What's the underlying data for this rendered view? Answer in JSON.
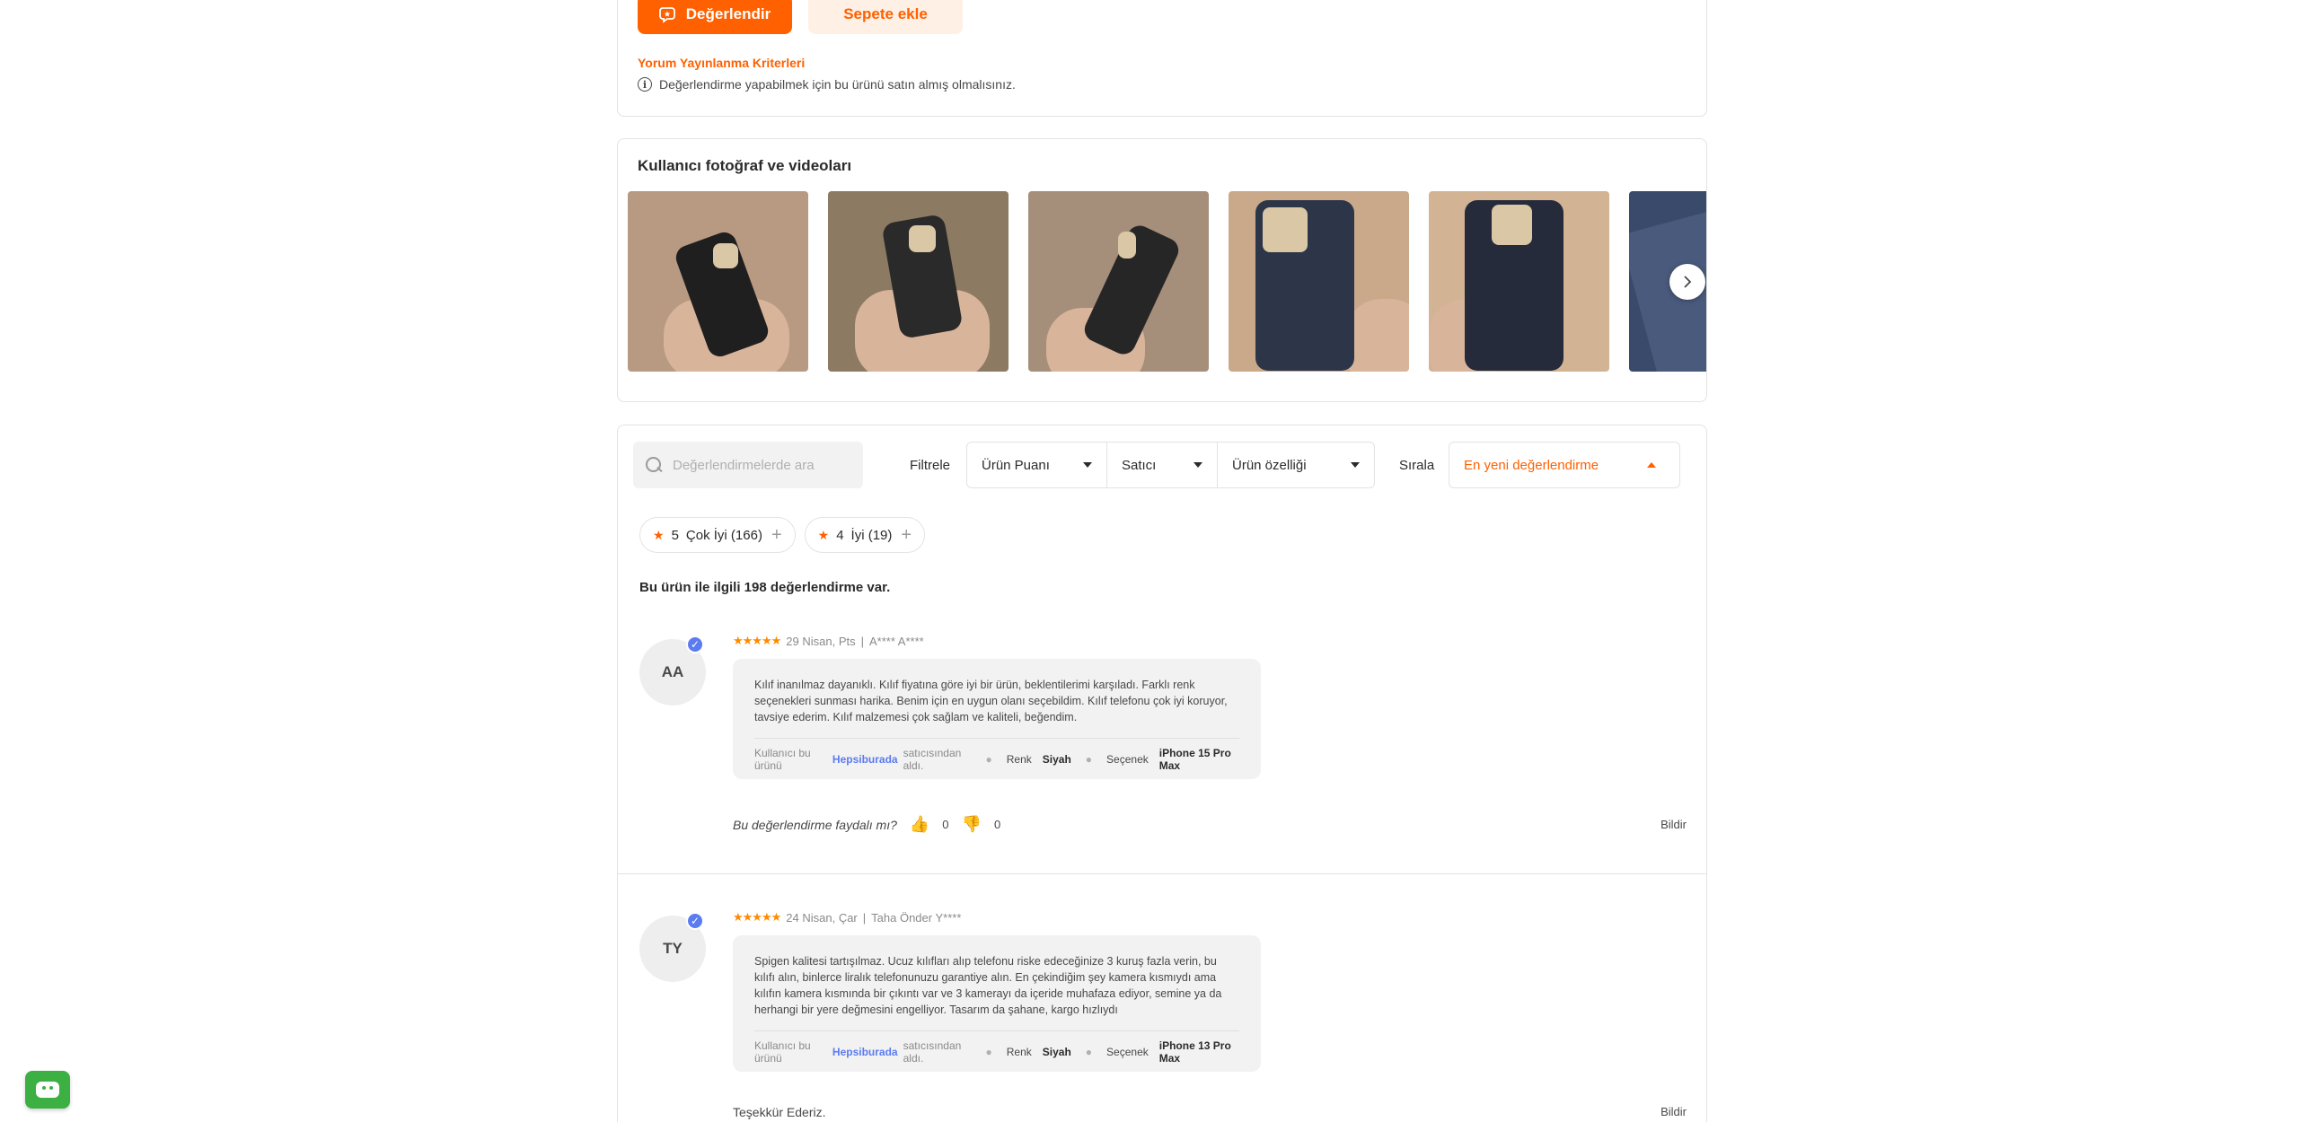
{
  "actions": {
    "rate_label": "Değerlendir",
    "cart_label": "Sepete ekle",
    "criteria_link": "Yorum Yayınlanma Kriterleri",
    "criteria_note": "Değerlendirme yapabilmek için bu ürünü satın almış olmalısınız."
  },
  "photos": {
    "title": "Kullanıcı fotoğraf ve videoları",
    "items": [
      {
        "bg": "#b89a83",
        "phone": "#1f1f1f"
      },
      {
        "bg": "#8c7a63",
        "phone": "#2a2a2a"
      },
      {
        "bg": "#a58f7a",
        "phone": "#262626"
      },
      {
        "bg": "#c9a98a",
        "phone": "#2d3648"
      },
      {
        "bg": "#d2b393",
        "phone": "#252b3a"
      },
      {
        "bg": "#3a4a6a",
        "phone": "#4a5a7c"
      }
    ]
  },
  "filters": {
    "search_placeholder": "Değerlendirmelerde ara",
    "filter_label": "Filtrele",
    "dropdowns": [
      "Ürün Puanı",
      "Satıcı",
      "Ürün özelliği"
    ],
    "sort_label": "Sırala",
    "sort_value": "En yeni değerlendirme"
  },
  "chips": [
    {
      "stars": "5",
      "label": "Çok İyi (166)"
    },
    {
      "stars": "4",
      "label": "İyi (19)"
    }
  ],
  "review_count_text": "Bu ürün ile ilgili 198 değerlendirme var.",
  "reviews": [
    {
      "initials": "AA",
      "stars": "★★★★★",
      "date": "29 Nisan, Pts",
      "sep": "|",
      "author": "A**** A****",
      "text": "Kılıf inanılmaz dayanıklı.  Kılıf fiyatına göre iyi bir ürün, beklentilerimi karşıladı. Farklı renk seçenekleri sunması harika. Benim için en uygun olanı seçebildim. Kılıf telefonu çok iyi koruyor, tavsiye ederim.  Kılıf malzemesi çok sağlam ve kaliteli, beğendim.",
      "seller_prefix": "Kullanıcı bu ürünü",
      "seller": "Hepsiburada",
      "seller_suffix": "satıcısından aldı.",
      "color_label": "Renk",
      "color_value": "Siyah",
      "option_label": "Seçenek",
      "option_value": "iPhone 15 Pro Max",
      "helpful_q": "Bu değerlendirme faydalı mı?",
      "up_votes": "0",
      "down_votes": "0",
      "report": "Bildir"
    },
    {
      "initials": "TY",
      "stars": "★★★★★",
      "date": "24 Nisan, Çar",
      "sep": "|",
      "author": "Taha Önder Y****",
      "text": "Spigen kalitesi tartışılmaz. Ucuz kılıfları alıp telefonu riske edeceğinize 3 kuruş fazla verin, bu kılıfı alın, binlerce liralık telefonunuzu garantiye alın. En çekindiğim şey kamera kısmıydı ama kılıfın kamera kısmında bir çıkıntı var ve 3 kamerayı da içeride muhafaza ediyor, semine ya da herhangi bir yere değmesini engelliyor. Tasarım da şahane, kargo hızlıydı",
      "seller_prefix": "Kullanıcı bu ürünü",
      "seller": "Hepsiburada",
      "seller_suffix": "satıcısından aldı.",
      "color_label": "Renk",
      "color_value": "Siyah",
      "option_label": "Seçenek",
      "option_value": "iPhone 13 Pro Max",
      "thanks": "Teşekkür Ederiz.",
      "report": "Bildir"
    }
  ]
}
